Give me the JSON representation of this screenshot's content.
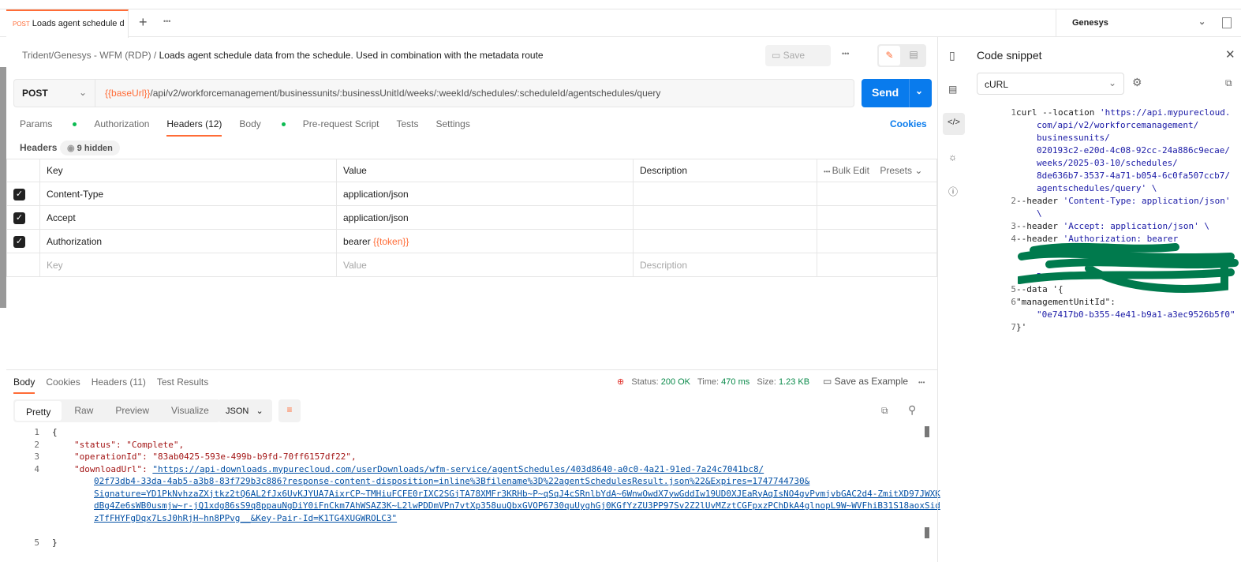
{
  "tab": {
    "method": "POST",
    "title": "Loads agent schedule d"
  },
  "environment": "Genesys",
  "breadcrumb": {
    "collection": "Trident/Genesys - WFM (RDP)",
    "separator": "/",
    "request": "Loads agent schedule data from the schedule. Used in combination with the metadata route"
  },
  "toolbar": {
    "save": "Save"
  },
  "request": {
    "method": "POST",
    "url_var": "{{baseUrl}}",
    "url_path": "/api/v2/workforcemanagement/businessunits/:businessUnitId/weeks/:weekId/schedules/:scheduleId/agentschedules/query",
    "send": "Send"
  },
  "req_tabs": [
    "Params",
    "Authorization",
    "Headers (12)",
    "Body",
    "Pre-request Script",
    "Tests",
    "Settings"
  ],
  "cookies": "Cookies",
  "headers": {
    "label": "Headers",
    "hidden": "9 hidden",
    "columns": [
      "Key",
      "Value",
      "Description"
    ],
    "bulk_edit": "Bulk Edit",
    "presets": "Presets",
    "rows": [
      {
        "key": "Content-Type",
        "value": "application/json"
      },
      {
        "key": "Accept",
        "value": "application/json"
      },
      {
        "key": "Authorization",
        "value": "bearer ",
        "value_var": "{{token}}"
      }
    ],
    "placeholder": {
      "key": "Key",
      "value": "Value",
      "description": "Description"
    }
  },
  "response": {
    "tabs": [
      "Body",
      "Cookies",
      "Headers (11)",
      "Test Results"
    ],
    "status_label": "Status:",
    "status": "200 OK",
    "time_label": "Time:",
    "time": "470 ms",
    "size_label": "Size:",
    "size": "1.23 KB",
    "save_example": "Save as Example",
    "views": [
      "Pretty",
      "Raw",
      "Preview",
      "Visualize"
    ],
    "format": "JSON",
    "lines": [
      "{",
      "\"status\": \"Complete\",",
      "\"operationId\": \"83ab0425-593e-499b-b9fd-70ff6157df22\","
    ],
    "download_key": "\"downloadUrl\": ",
    "download_url": [
      "\"https://api-downloads.mypurecloud.com/userDownloads/wfm-service/agentSchedules/403d8640-a0c0-4a21-91ed-7a24c7041bc8/",
      "02f73db4-33da-4ab5-a3b8-83f729b3c886?response-content-disposition=inline%3Bfilename%3D%22agentSchedulesResult.json%22&Expires=1747744730&",
      "Signature=YD1PkNvhzaZXjtkz2tQ6AL2fJx6UvKJYUA7AixrCP~TMHiuFCFE0rIXC2SGjTA78XMFr3KRHb~P~qSqJ4cSRnlbYdA~6WnwOwdX7ywGddIw19UD0XJEaRyAqIsNO4gvPvmjvbGAC2d4-ZmitXD97JWXK",
      "dBg4Ze6sWB0usmjw~r-jQ1xdg86sS9q8ppauNgDiY0iFnCkm7AhWSAZ3K~L2lwPDDmVPn7vtXp358uuQbxGVOP6730quUyghGj0KGfYzZU3PP97Sv2Z2lUvMZztCGFpxzPChDkA4glnopL9W~WVFhiB31S18aoxSid",
      "zTfFHYFgDqx7LsJ0hRjH~hn8PPvg__&Key-Pair-Id=K1TG4XUGWROLC3\""
    ],
    "last": "}"
  },
  "snippet": {
    "title": "Code snippet",
    "language": "cURL",
    "lines": [
      {
        "n": "1",
        "text": "curl --location ",
        "str": "'https://api.mypurecloud.",
        "cont": [
          "com/api/v2/workforcemanagement/",
          "businessunits/",
          "020193c2-e20d-4c08-92cc-24a886c9ecae/",
          "weeks/2025-03-10/schedules/",
          "8de636b7-3537-4a71-b054-6c0fa507ccb7/",
          "agentschedules/query' \\"
        ]
      },
      {
        "n": "2",
        "text": "--header ",
        "str": "'Content-Type: application/json'",
        "cont": [
          "\\"
        ]
      },
      {
        "n": "3",
        "text": "--header ",
        "str": "'Accept: application/json' \\",
        "cont": []
      },
      {
        "n": "4",
        "text": "--header ",
        "str": "'Authorization: bearer",
        "cont": [
          "",
          "",
          "Rg' \\"
        ]
      },
      {
        "n": "5",
        "text": "--data '{",
        "str": "",
        "cont": []
      },
      {
        "n": "6",
        "text": "  \"managementUnitId\":",
        "str": "",
        "cont": [
          "\"0e7417b0-b355-4e41-b9a1-a3ec9526b5f0\""
        ]
      },
      {
        "n": "7",
        "text": "}'",
        "str": "",
        "cont": []
      }
    ]
  },
  "colors": {
    "accent": "#ff6c37",
    "send": "#097bed",
    "ok": "#0cbb52",
    "redaction": "#007a4d"
  }
}
